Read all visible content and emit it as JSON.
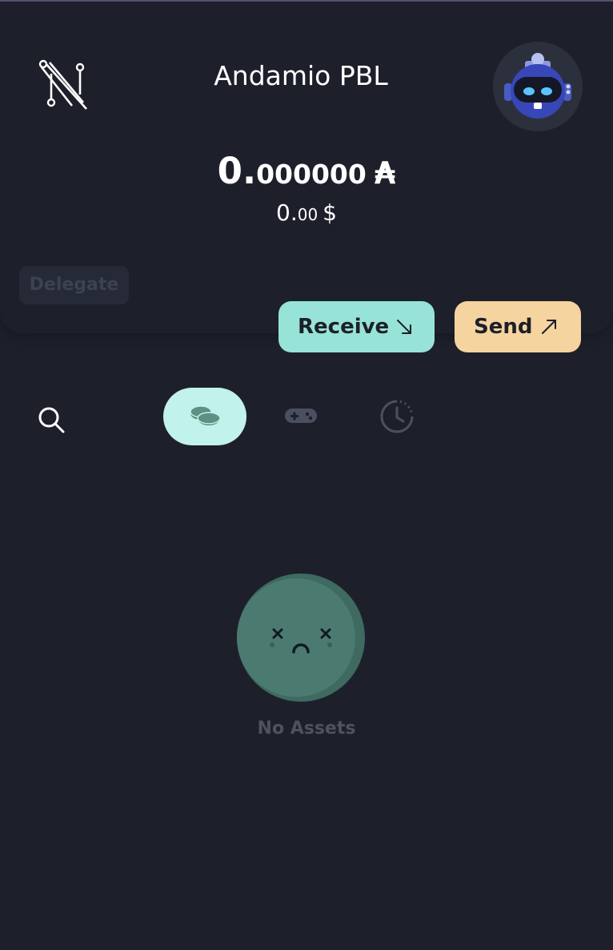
{
  "header": {
    "wallet_name": "Andamio PBL"
  },
  "balance": {
    "integer": "0.",
    "decimals": "000000",
    "symbol": "₳"
  },
  "fiat": {
    "integer": "0.",
    "decimals": "00",
    "symbol": "$"
  },
  "actions": {
    "delegate_label": "Delegate",
    "receive_label": "Receive",
    "send_label": "Send"
  },
  "tabs": [
    {
      "name": "assets",
      "icon": "coins-icon",
      "active": true
    },
    {
      "name": "collectibles",
      "icon": "gamepad-icon",
      "active": false
    },
    {
      "name": "history",
      "icon": "clock-icon",
      "active": false
    }
  ],
  "empty_state": {
    "label": "No Assets"
  },
  "colors": {
    "background": "#1d202b",
    "receive": "#97e3d8",
    "send": "#f5d49f",
    "active_tab": "#c1f2ec",
    "empty_face": "#4b7b70"
  }
}
